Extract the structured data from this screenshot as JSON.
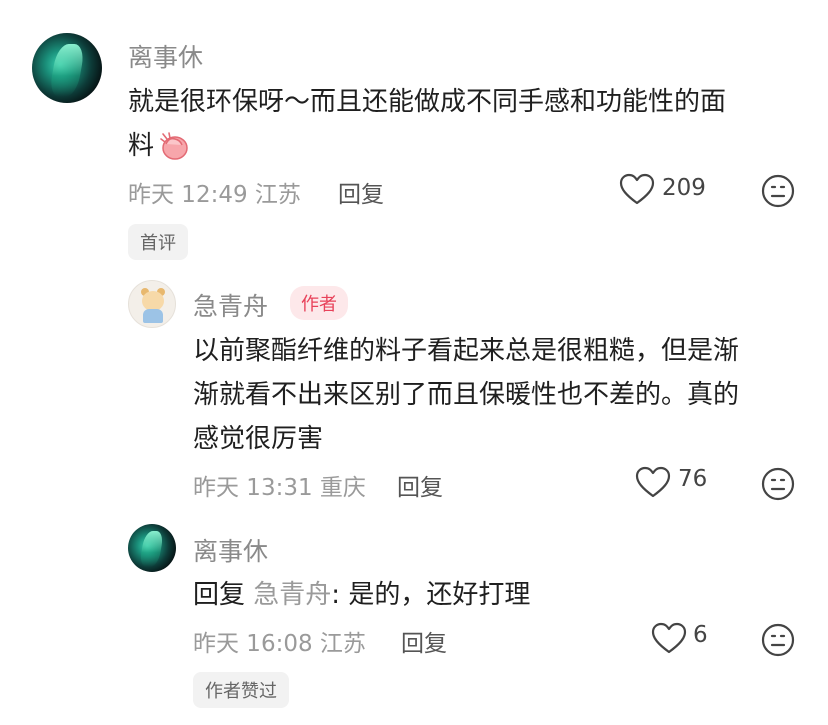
{
  "comments": [
    {
      "name": "离事休",
      "text_line1": "就是很环保呀～而且还能做成不同手感和功能性的面",
      "text_line2": "料",
      "emoji": "clap-icon",
      "time": "昨天 12:49",
      "location": "江苏",
      "reply_label": "回复",
      "likes": "209",
      "tag": "首评"
    },
    {
      "name": "急青舟",
      "author_badge": "作者",
      "text_line1": "以前聚酯纤维的料子看起来总是很粗糙，但是渐",
      "text_line2": "渐就看不出来区别了而且保暖性也不差的。真的",
      "text_line3": "感觉很厉害",
      "time": "昨天 13:31",
      "location": "重庆",
      "reply_label": "回复",
      "likes": "76"
    },
    {
      "name": "离事休",
      "reply_prefix": "回复",
      "reply_to": "急青舟",
      "text": ": 是的，还好打理",
      "time": "昨天 16:08",
      "location": "江苏",
      "reply_label": "回复",
      "likes": "6",
      "tag": "作者赞过"
    }
  ],
  "icons": {
    "like": "heart-outline-icon",
    "emoji_react": "smiley-face-icon"
  },
  "colors": {
    "author_badge_text": "#e8425a",
    "author_badge_bg": "#fde8ea",
    "muted_text": "#9a9a9a"
  }
}
